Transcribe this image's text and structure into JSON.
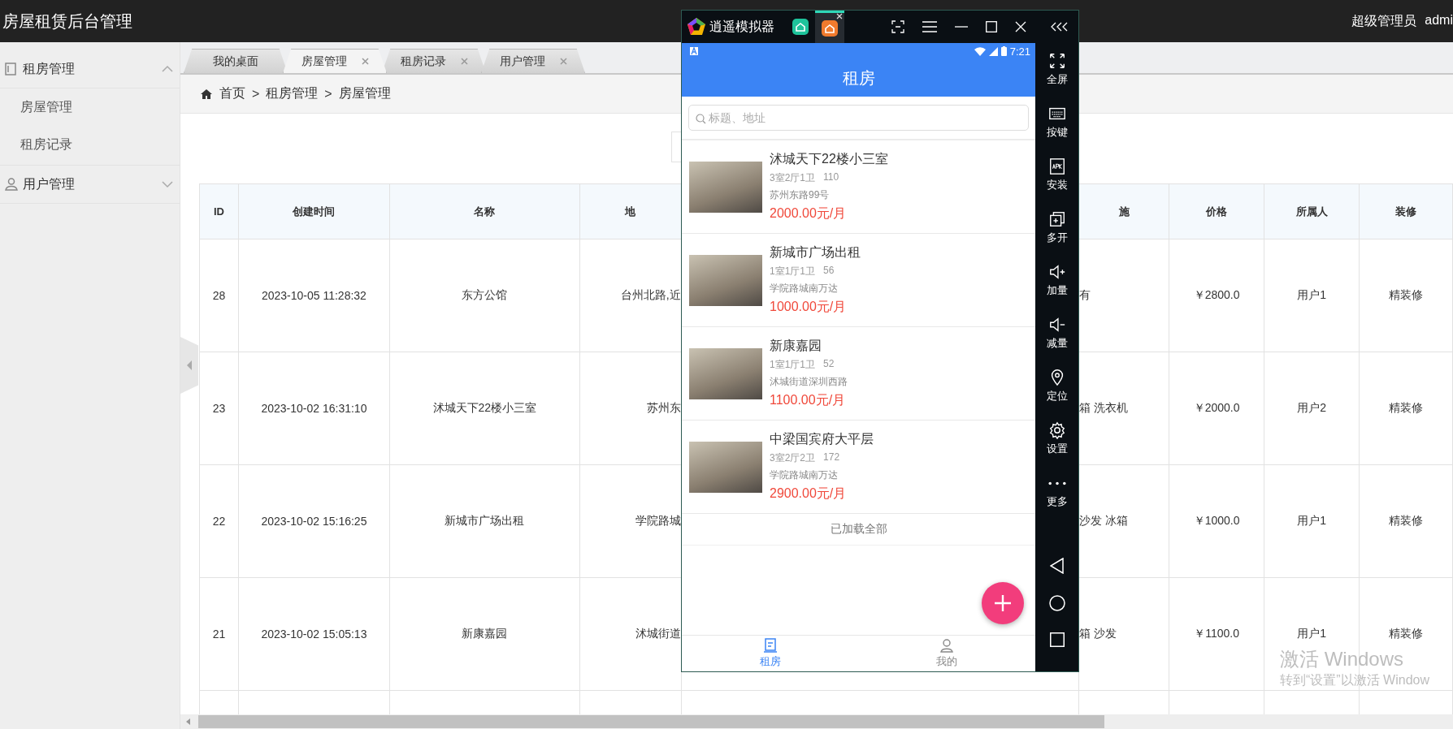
{
  "header": {
    "title": "房屋租赁后台管理",
    "role": "超级管理员",
    "user": "admi"
  },
  "sidebar": {
    "groups": [
      {
        "label": "租房管理",
        "expanded": true,
        "children": [
          {
            "label": "房屋管理"
          },
          {
            "label": "租房记录"
          }
        ]
      },
      {
        "label": "用户管理",
        "expanded": false
      }
    ]
  },
  "tabs": [
    {
      "label": "我的桌面",
      "selected": false,
      "closable": false
    },
    {
      "label": "房屋管理",
      "selected": true,
      "closable": true
    },
    {
      "label": "租房记录",
      "selected": false,
      "closable": true
    },
    {
      "label": "用户管理",
      "selected": false,
      "closable": true
    }
  ],
  "breadcrumb": [
    {
      "label": "首页"
    },
    {
      "separator": ">",
      "label": "租房管理"
    },
    {
      "separator": ">",
      "label": "房屋管理"
    }
  ],
  "table": {
    "columns": [
      "ID",
      "创建时间",
      "名称",
      "地",
      "施",
      "价格",
      "所属人",
      "装修"
    ],
    "rows": [
      {
        "cells": [
          "28",
          "2023-10-05 11:28:32",
          "东方公馆",
          "台州北路,近",
          "有",
          "￥2800.0",
          "用户1",
          "精装修"
        ]
      },
      {
        "cells": [
          "23",
          "2023-10-02 16:31:10",
          "沭城天下22楼小三室",
          "苏州东",
          "箱 洗衣机",
          "￥2000.0",
          "用户2",
          "精装修"
        ]
      },
      {
        "cells": [
          "22",
          "2023-10-02 15:16:25",
          "新城市广场出租",
          "学院路城",
          "沙发 冰箱",
          "￥1000.0",
          "用户1",
          "精装修"
        ]
      },
      {
        "cells": [
          "21",
          "2023-10-02 15:05:13",
          "新康嘉园",
          "沭城街道",
          "箱 沙发",
          "￥1100.0",
          "用户1",
          "精装修"
        ]
      }
    ]
  },
  "emulator": {
    "title": "逍遥模拟器",
    "app_tabs": [
      {
        "selected": false
      },
      {
        "selected": true
      }
    ],
    "toolbar": [
      {
        "label": "全屏"
      },
      {
        "label": "按键"
      },
      {
        "label": "安装"
      },
      {
        "label": "多开"
      },
      {
        "label": "加量"
      },
      {
        "label": "减量"
      },
      {
        "label": "定位"
      },
      {
        "label": "设置"
      },
      {
        "label": "更多"
      }
    ],
    "phone": {
      "time": "7:21",
      "title": "租房",
      "search_placeholder": "标题、地址",
      "listings": [
        {
          "title": "沭城天下22楼小三室",
          "layout": "3室2厅1卫",
          "area": "110",
          "address": "苏州东路99号",
          "price": "2000.00元/月"
        },
        {
          "title": "新城市广场出租",
          "layout": "1室1厅1卫",
          "area": "56",
          "address": "学院路城南万达",
          "price": "1000.00元/月"
        },
        {
          "title": "新康嘉园",
          "layout": "1室1厅1卫",
          "area": "52",
          "address": "沭城街道深圳西路",
          "price": "1100.00元/月"
        },
        {
          "title": "中梁国宾府大平层",
          "layout": "3室2厅2卫",
          "area": "172",
          "address": "学院路城南万达",
          "price": "2900.00元/月"
        }
      ],
      "footer_note": "已加载全部",
      "nav": [
        {
          "label": "租房",
          "selected": true
        },
        {
          "label": "我的",
          "selected": false
        }
      ]
    }
  },
  "os_notice": {
    "title": "激活 Windows",
    "hint": "转到“设置”以激活 Window"
  }
}
